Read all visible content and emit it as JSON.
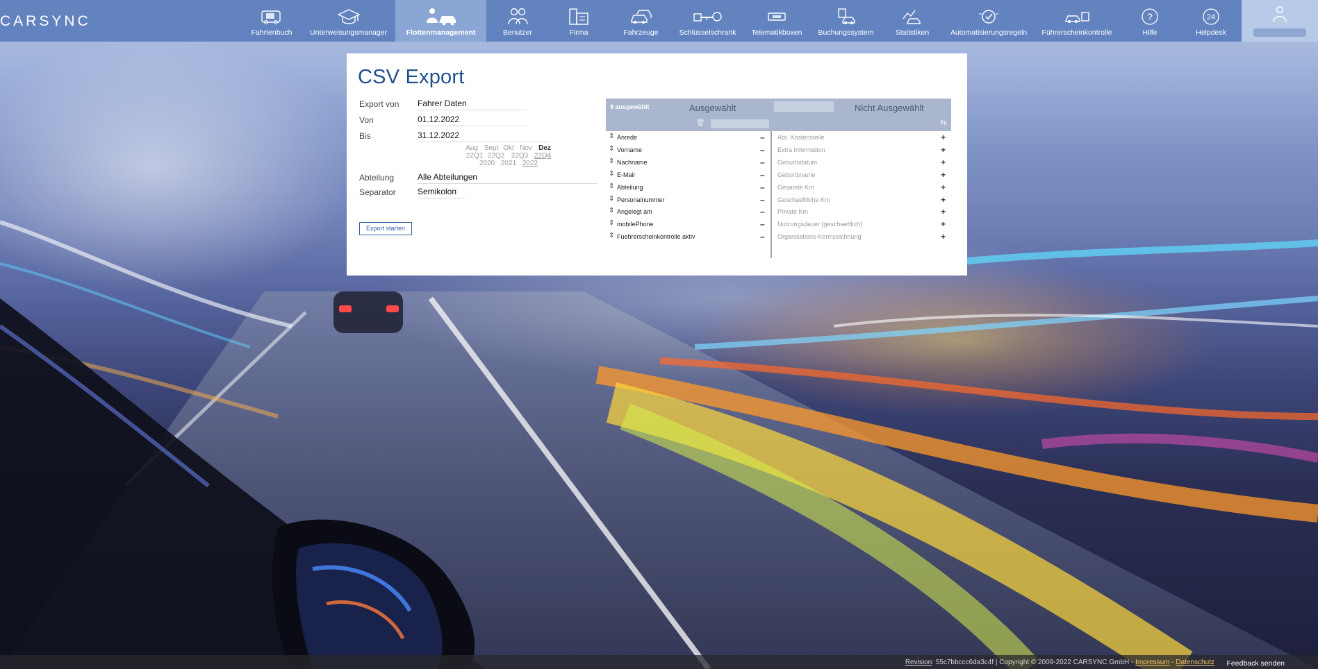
{
  "app": {
    "logo_text": "CARSYNC",
    "accent": "#5c7ebc",
    "active_tab_color": "#8ca8d6"
  },
  "nav": {
    "items": [
      {
        "label": "Fahrtenbuch",
        "icon": "logbook-icon"
      },
      {
        "label": "Unterweisungsmanager",
        "icon": "graduation-cap-icon"
      },
      {
        "label": "Flottenmanagement",
        "icon": "fleet-management-icon",
        "active": true
      },
      {
        "label": "Benutzer",
        "icon": "users-icon"
      },
      {
        "label": "Firma",
        "icon": "building-icon"
      },
      {
        "label": "Fahrzeuge",
        "icon": "cars-icon"
      },
      {
        "label": "Schlüsselschrank",
        "icon": "key-cabinet-icon"
      },
      {
        "label": "Telematikboxen",
        "icon": "telematics-box-icon"
      },
      {
        "label": "Buchungssystem",
        "icon": "booking-icon"
      },
      {
        "label": "Statistiken",
        "icon": "statistics-icon"
      },
      {
        "label": "Automatisierungsregeln",
        "icon": "automation-clock-icon"
      },
      {
        "label": "Führerscheinkontrolle",
        "icon": "license-check-icon"
      },
      {
        "label": "Hilfe",
        "icon": "help-icon",
        "glyph": "?"
      },
      {
        "label": "Helpdesk",
        "icon": "helpdesk-24-icon",
        "glyph": "24"
      }
    ],
    "user_icon": "user-icon"
  },
  "export": {
    "title": "CSV Export",
    "labels": {
      "export_von": "Export von",
      "von": "Von",
      "bis": "Bis",
      "abteilung": "Abteilung",
      "separator": "Separator"
    },
    "values": {
      "export_von": "Fahrer Daten",
      "von": "01.12.2022",
      "bis": "31.12.2022",
      "abteilung": "Alle Abteilungen",
      "separator": "Semikolon"
    },
    "months": [
      "Aug",
      "Sept",
      "Okt",
      "Nov",
      "Dez"
    ],
    "quarters": [
      "22Q1",
      "22Q2",
      "22Q3",
      "22Q4"
    ],
    "years": [
      "2020",
      "2021",
      "2022"
    ],
    "button": "Export starten"
  },
  "chooser": {
    "count_label": "9 ausgewählt",
    "selected_title": "Ausgewählt",
    "not_selected_title": "Nicht Ausgewählt",
    "selected": [
      "Anrede",
      "Vorname",
      "Nachname",
      "E-Mail",
      "Abteilung",
      "Personalnummer",
      "Angelegt am",
      "mobilePhone",
      "Fuehrerscheinkontrolle aktiv"
    ],
    "not_selected": [
      "Abt. Kostenstelle",
      "Extra Information",
      "Geburtsdatum",
      "Geburtsname",
      "Gesamte Km",
      "Geschaeftliche Km",
      "Private Km",
      "Nutzungsdauer (geschaeftlich)",
      "Organisations-Kennzeichnung"
    ]
  },
  "footer": {
    "revision_label": "Revision",
    "revision_value": ": 55c7bbccc6da3c4f | Copyright © 2009-2022 CARSYNC GmbH - ",
    "impressum": "Impressum",
    "sep": " - ",
    "datenschutz": "Datenschutz",
    "feedback": "Feedback senden"
  }
}
